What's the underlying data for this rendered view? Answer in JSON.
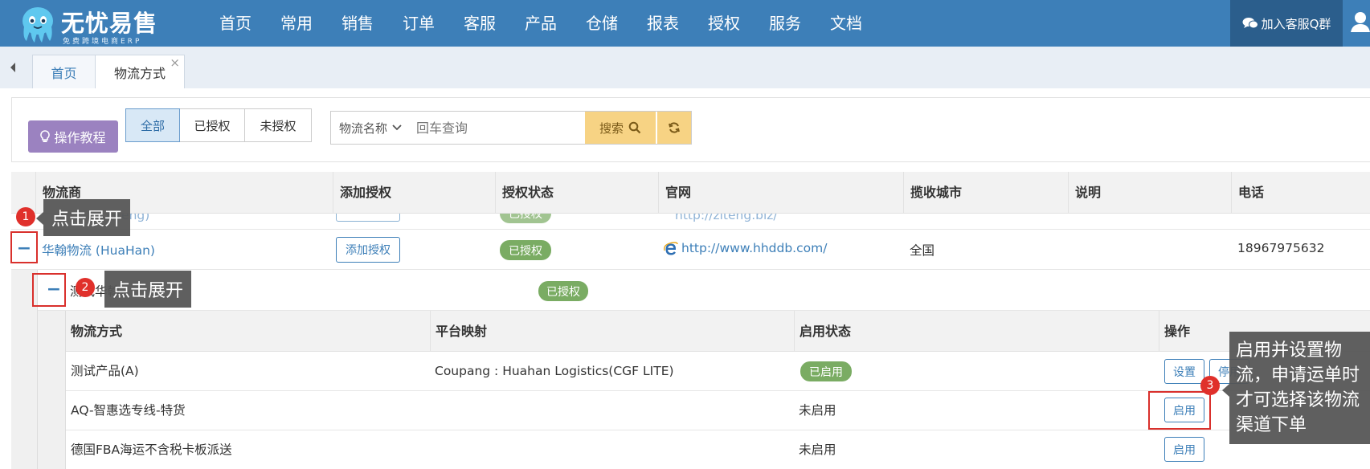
{
  "app": {
    "logo_title": "无忧易售",
    "logo_subtitle": "免费跨境电商ERP",
    "nav": [
      "首页",
      "常用",
      "销售",
      "订单",
      "客服",
      "产品",
      "仓储",
      "报表",
      "授权",
      "服务",
      "文档"
    ],
    "qq_group": "加入客服Q群"
  },
  "tabs": {
    "home": "首页",
    "active": "物流方式",
    "close": "×"
  },
  "toolbar": {
    "tutorial": "操作教程",
    "filters": [
      "全部",
      "已授权",
      "未授权"
    ],
    "search_field": "物流名称",
    "search_placeholder": "回车查询",
    "search_button": "搜索"
  },
  "table": {
    "headers": [
      "物流商",
      "添加授权",
      "授权状态",
      "官网",
      "揽收城市",
      "说明",
      "电话"
    ],
    "partial_row": {
      "provider": "(Ziteng)",
      "status": "已授权",
      "website": "http://ziteng.biz/"
    },
    "row": {
      "expander": "−",
      "provider": "华翰物流 (HuaHan)",
      "add_auth": "添加授权",
      "status": "已授权",
      "website": "http://www.hhddb.com/",
      "city": "全国",
      "phone": "18967975632"
    },
    "sub_row": {
      "expander": "−",
      "name": "测试华翰",
      "status": "已授权"
    },
    "inner_headers": [
      "物流方式",
      "平台映射",
      "启用状态",
      "操作"
    ],
    "inner_rows": [
      {
        "method": "测试产品(A)",
        "mapping": "Coupang : Huahan Logistics(CGF LITE)",
        "status": "已启用",
        "actions": [
          "设置",
          "停用"
        ]
      },
      {
        "method": "AQ-智惠选专线-特货",
        "mapping": "",
        "status": "未启用",
        "actions": [
          "启用"
        ]
      },
      {
        "method": "德国FBA海运不含税卡板派送",
        "mapping": "",
        "status": "未启用",
        "actions": [
          "启用"
        ]
      }
    ]
  },
  "annotations": {
    "step1": {
      "num": "1",
      "text": "点击展开"
    },
    "step2": {
      "num": "2",
      "text": "点击展开"
    },
    "step3": {
      "num": "3",
      "text": "启用并设置物流，申请运单时才可选择该物流渠道下单"
    }
  },
  "colors": {
    "header_blue": "#3d7fb8",
    "qq_bg": "#2b5e8c",
    "tutorial_purple": "#9b82c0",
    "search_yellow": "#f7d384",
    "badge_green": "#7aac63",
    "annotation_red": "#d9302c"
  }
}
